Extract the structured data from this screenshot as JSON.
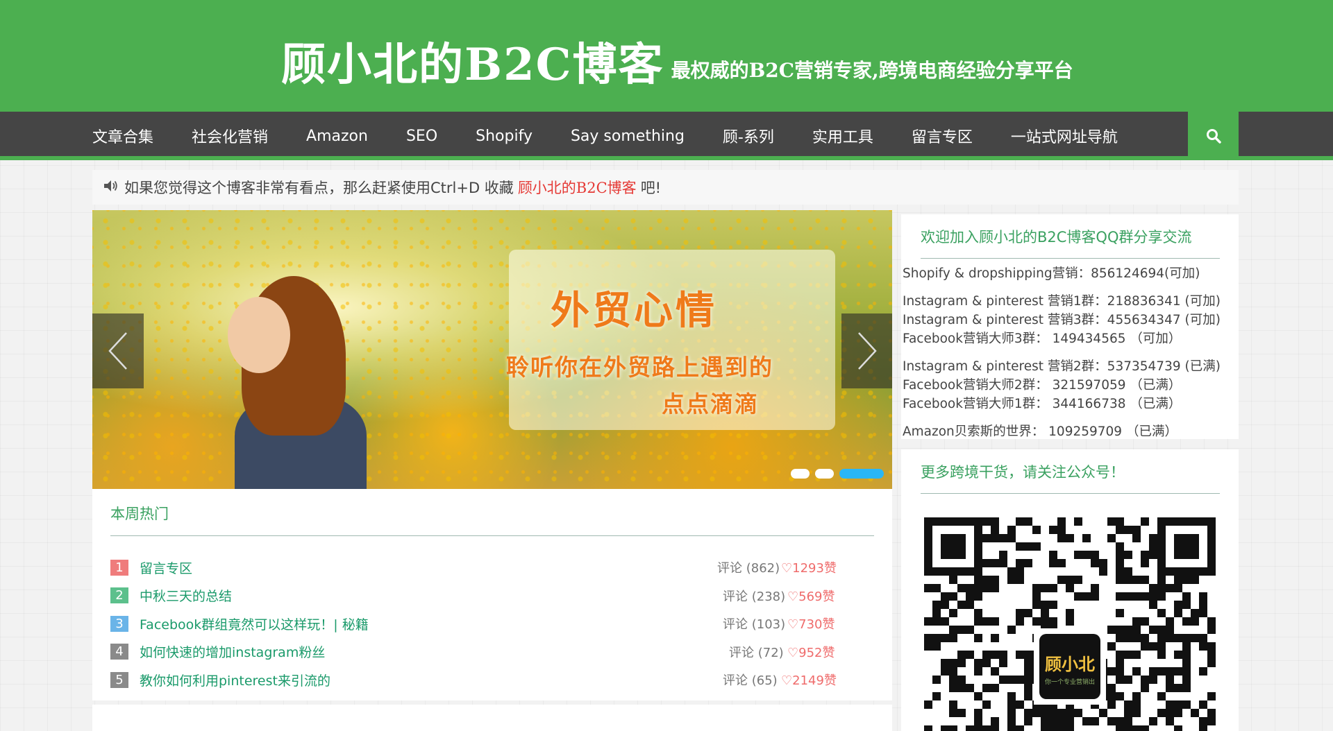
{
  "header": {
    "title": "顾小北的B2C博客",
    "tagline": "最权威的B2C营销专家,跨境电商经验分享平台"
  },
  "nav": {
    "items": [
      "文章合集",
      "社会化营销",
      "Amazon",
      "SEO",
      "Shopify",
      "Say something",
      "顾-系列",
      "实用工具",
      "留言专区",
      "一站式网址导航"
    ],
    "search_icon": "search-icon"
  },
  "notice": {
    "text_before": "如果您觉得这个博客非常有看点，那么赶紧使用Ctrl+D 收藏",
    "brand": "顾小北的B2C博客",
    "text_after": "吧!",
    "icon": "speaker-icon"
  },
  "slider": {
    "title": "外贸心情",
    "line1": "聆听你在外贸路上遇到的",
    "line2": "点点滴滴",
    "active_slide": 3,
    "slide_count": 3
  },
  "hot": {
    "title": "本周热门",
    "items": [
      {
        "num": "1",
        "title": "留言专区",
        "comments": "评论 (862)",
        "likes": "1293赞",
        "color": "#ef7c7c"
      },
      {
        "num": "2",
        "title": "中秋三天的总结",
        "comments": "评论 (238)",
        "likes": "569赞",
        "color": "#5cc08c"
      },
      {
        "num": "3",
        "title": "Facebook群组竟然可以这样玩！| 秘籍",
        "comments": "评论 (103)",
        "likes": "730赞",
        "color": "#6ab4e8"
      },
      {
        "num": "4",
        "title": "如何快速的增加instagram粉丝",
        "comments": "评论 (72)",
        "likes": "952赞",
        "color": "#8a8a8a"
      },
      {
        "num": "5",
        "title": "教你如何利用pinterest来引流的",
        "comments": "评论 (65)",
        "likes": "2149赞",
        "color": "#8a8a8a"
      }
    ]
  },
  "sidebar": {
    "qq_title": "欢迎加入顾小北的B2C博客QQ群分享交流",
    "qq_groups": [
      [
        "Shopify & dropshipping营销：856124694(可加)"
      ],
      [
        "Instagram & pinterest 营销1群：218836341 (可加)",
        "Instagram & pinterest 营销3群：455634347 (可加)",
        "Facebook营销大师3群： 149434565 （可加）"
      ],
      [
        "Instagram & pinterest 营销2群：537354739 (已满)",
        "Facebook营销大师2群： 321597059 （已满）",
        "Facebook营销大师1群： 344166738 （已满）"
      ],
      [
        "Amazon贝索斯的世界： 109259709 （已满）"
      ]
    ],
    "wechat_title": "更多跨境干货，请关注公众号！",
    "qr_logo_text": "顾小北",
    "qr_logo_sub": "你一个专业营销出"
  },
  "colors": {
    "brand_green": "#4caf50",
    "nav_dark": "#454545",
    "accent_red": "#e53935",
    "link_green": "#1a9a6a",
    "slider_dot": "#29b6f6"
  }
}
